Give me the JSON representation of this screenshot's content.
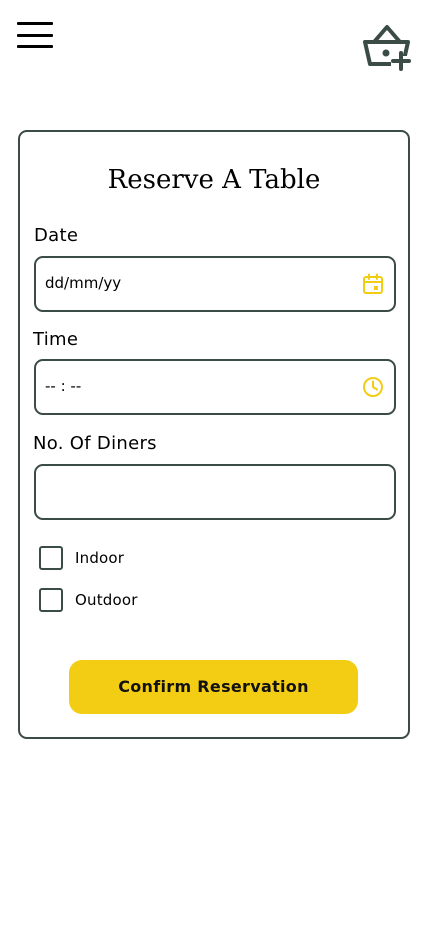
{
  "header": {
    "menu_icon": "hamburger-menu-icon",
    "cart_icon": "basket-add-icon"
  },
  "form": {
    "title": "Reserve A Table",
    "date": {
      "label": "Date",
      "placeholder": "dd/mm/yy",
      "icon": "calendar-icon"
    },
    "time": {
      "label": "Time",
      "placeholder": "-- : --",
      "icon": "clock-icon"
    },
    "diners": {
      "label": "No. Of Diners",
      "value": ""
    },
    "options": [
      {
        "label": "Indoor",
        "checked": false
      },
      {
        "label": "Outdoor",
        "checked": false
      }
    ],
    "submit_label": "Confirm Reservation"
  },
  "colors": {
    "accent": "#f3cc14",
    "border": "#3b4b45",
    "icon_dark": "#3b4b45"
  }
}
